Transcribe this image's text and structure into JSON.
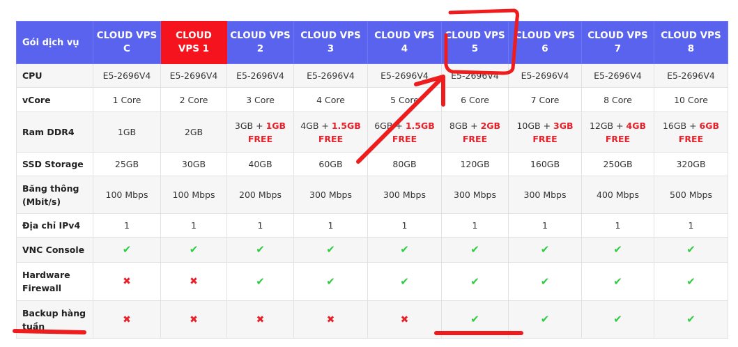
{
  "header": {
    "label": "Gói dịch vụ",
    "plans": [
      "CLOUD VPS C",
      "CLOUD VPS 1",
      "CLOUD VPS 2",
      "CLOUD VPS 3",
      "CLOUD VPS 4",
      "CLOUD VPS 5",
      "CLOUD VPS 6",
      "CLOUD VPS 7",
      "CLOUD VPS 8"
    ],
    "highlight_color": "#f5141e",
    "header_color": "#5a63ee"
  },
  "rows": [
    {
      "label": "CPU",
      "cells": [
        {
          "main": "E5-2696V4"
        },
        {
          "main": "E5-2696V4"
        },
        {
          "main": "E5-2696V4"
        },
        {
          "main": "E5-2696V4"
        },
        {
          "main": "E5-2696V4"
        },
        {
          "main": "E5-2696V4"
        },
        {
          "main": "E5-2696V4"
        },
        {
          "main": "E5-2696V4"
        },
        {
          "main": "E5-2696V4"
        }
      ]
    },
    {
      "label": "vCore",
      "cells": [
        {
          "main": "1 Core"
        },
        {
          "main": "2 Core"
        },
        {
          "main": "3 Core"
        },
        {
          "main": "4 Core"
        },
        {
          "main": "5 Core"
        },
        {
          "main": "6 Core"
        },
        {
          "main": "7 Core"
        },
        {
          "main": "8 Core"
        },
        {
          "main": "10 Core"
        }
      ]
    },
    {
      "label": "Ram DDR4",
      "cells": [
        {
          "main": "1GB"
        },
        {
          "main": "2GB"
        },
        {
          "main": "3GB + ",
          "free": "1GB FREE"
        },
        {
          "main": "4GB + ",
          "free": "1.5GB FREE"
        },
        {
          "main": "6GB + ",
          "free": "1.5GB FREE"
        },
        {
          "main": "8GB + ",
          "free": "2GB FREE"
        },
        {
          "main": "10GB + ",
          "free": "3GB FREE"
        },
        {
          "main": "12GB + ",
          "free": "4GB FREE"
        },
        {
          "main": "16GB + ",
          "free": "6GB FREE"
        }
      ]
    },
    {
      "label": "SSD Storage",
      "cells": [
        {
          "main": "25GB"
        },
        {
          "main": "30GB"
        },
        {
          "main": "40GB"
        },
        {
          "main": "60GB"
        },
        {
          "main": "80GB"
        },
        {
          "main": "120GB"
        },
        {
          "main": "160GB"
        },
        {
          "main": "250GB"
        },
        {
          "main": "320GB"
        }
      ]
    },
    {
      "label": "Băng thông (Mbit/s)",
      "cells": [
        {
          "main": "100 Mbps"
        },
        {
          "main": "100 Mbps"
        },
        {
          "main": "200 Mbps"
        },
        {
          "main": "300 Mbps"
        },
        {
          "main": "300 Mbps"
        },
        {
          "main": "300 Mbps"
        },
        {
          "main": "300 Mbps"
        },
        {
          "main": "400 Mbps"
        },
        {
          "main": "500 Mbps"
        }
      ]
    },
    {
      "label": "Địa chỉ IPv4",
      "cells": [
        {
          "main": "1"
        },
        {
          "main": "1"
        },
        {
          "main": "1"
        },
        {
          "main": "1"
        },
        {
          "main": "1"
        },
        {
          "main": "1"
        },
        {
          "main": "1"
        },
        {
          "main": "1"
        },
        {
          "main": "1"
        }
      ]
    },
    {
      "label": "VNC Console",
      "cells": [
        {
          "icon": "check"
        },
        {
          "icon": "check"
        },
        {
          "icon": "check"
        },
        {
          "icon": "check"
        },
        {
          "icon": "check"
        },
        {
          "icon": "check"
        },
        {
          "icon": "check"
        },
        {
          "icon": "check"
        },
        {
          "icon": "check"
        }
      ]
    },
    {
      "label": "Hardware Firewall",
      "cells": [
        {
          "icon": "cross"
        },
        {
          "icon": "cross"
        },
        {
          "icon": "check"
        },
        {
          "icon": "check"
        },
        {
          "icon": "check"
        },
        {
          "icon": "check"
        },
        {
          "icon": "check"
        },
        {
          "icon": "check"
        },
        {
          "icon": "check"
        }
      ]
    },
    {
      "label": "Backup hàng tuần",
      "cells": [
        {
          "icon": "cross"
        },
        {
          "icon": "cross"
        },
        {
          "icon": "cross"
        },
        {
          "icon": "cross"
        },
        {
          "icon": "cross"
        },
        {
          "icon": "check"
        },
        {
          "icon": "check"
        },
        {
          "icon": "check"
        },
        {
          "icon": "check"
        }
      ]
    }
  ],
  "icons": {
    "check": "✔",
    "cross": "✖"
  },
  "annotation_color": "#ee1c1c"
}
